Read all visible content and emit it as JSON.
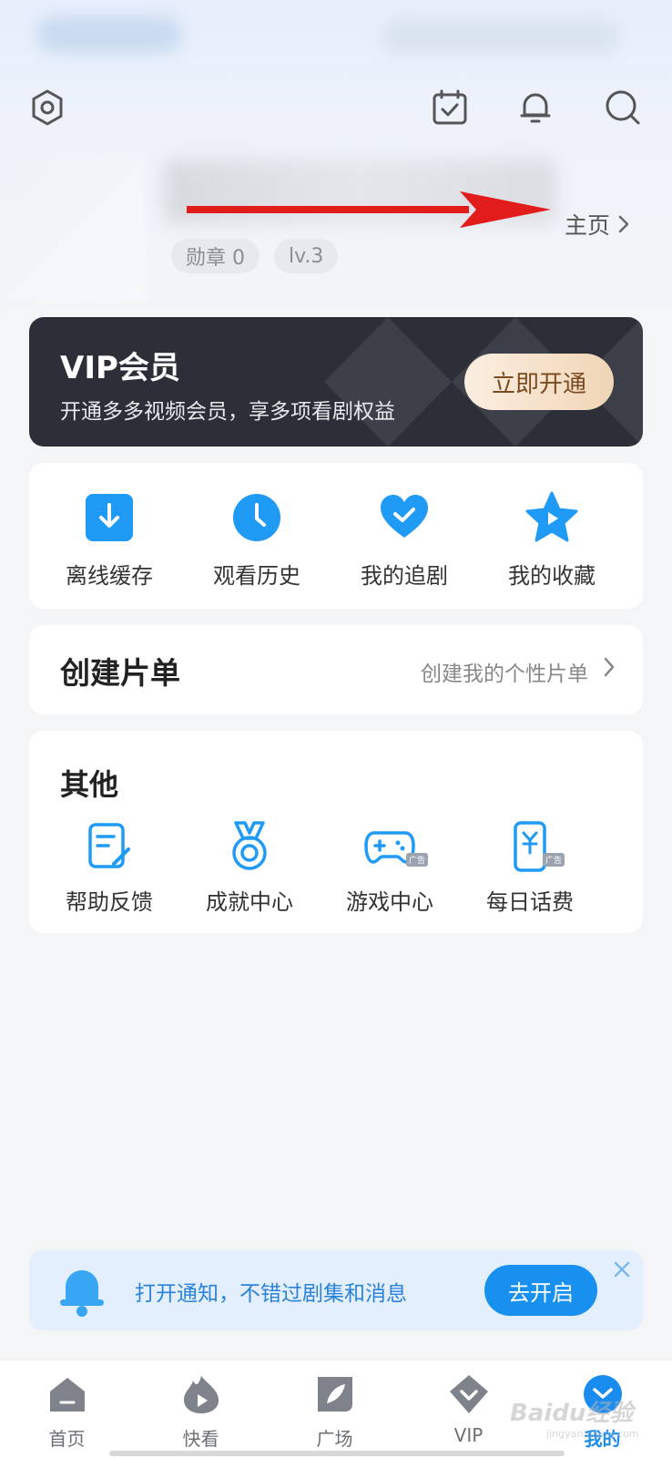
{
  "header": {
    "homepage_label": "主页",
    "badges": [
      "勋章 0",
      "lv.3"
    ]
  },
  "vip": {
    "title": "VIP会员",
    "subtitle": "开通多多视频会员，享多项看剧权益",
    "button": "立即开通"
  },
  "quick_actions": [
    {
      "label": "离线缓存",
      "icon": "download-icon"
    },
    {
      "label": "观看历史",
      "icon": "clock-icon"
    },
    {
      "label": "我的追剧",
      "icon": "heart-icon"
    },
    {
      "label": "我的收藏",
      "icon": "star-icon"
    }
  ],
  "playlist": {
    "title": "创建片单",
    "subtitle": "创建我的个性片单"
  },
  "other": {
    "title": "其他",
    "items": [
      {
        "label": "帮助反馈",
        "icon": "feedback-icon"
      },
      {
        "label": "成就中心",
        "icon": "medal-icon"
      },
      {
        "label": "游戏中心",
        "icon": "gamepad-icon",
        "tag": "广告"
      },
      {
        "label": "每日话费",
        "icon": "phone-bill-icon",
        "tag": "广告"
      }
    ]
  },
  "notify": {
    "text": "打开通知，不错过剧集和消息",
    "button": "去开启"
  },
  "tabs": [
    {
      "label": "首页",
      "icon": "home-icon"
    },
    {
      "label": "快看",
      "icon": "play-flame-icon"
    },
    {
      "label": "广场",
      "icon": "leaf-icon"
    },
    {
      "label": "VIP",
      "icon": "vip-diamond-icon"
    },
    {
      "label": "我的",
      "icon": "profile-icon",
      "active": true
    }
  ],
  "watermark": {
    "text": "Baidu经验",
    "sub": "jingyan.baidu.com"
  },
  "colors": {
    "accent": "#1a8cf0",
    "vip_bg": "#2c2f38",
    "vip_button": "#f0d5b6",
    "arrow": "#e21b1b"
  }
}
